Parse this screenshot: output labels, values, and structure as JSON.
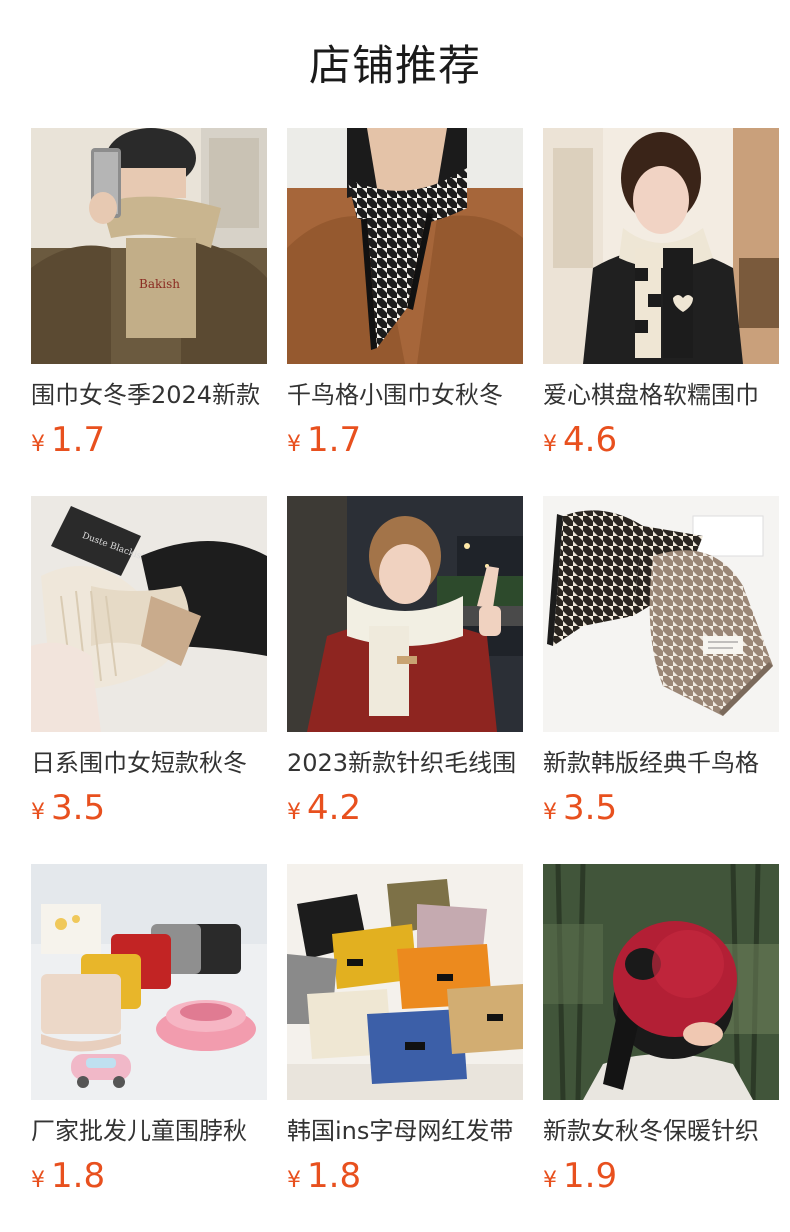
{
  "page": {
    "title": "店铺推荐",
    "currency_symbol": "¥",
    "price_color": "#e8501e"
  },
  "products": [
    {
      "name": "围巾女冬季2024新款",
      "price": "1.7",
      "image": "beige-knit-scarf-photo"
    },
    {
      "name": "千鸟格小围巾女秋冬",
      "price": "1.7",
      "image": "houndstooth-scarf-photo"
    },
    {
      "name": "爱心棋盘格软糯围巾",
      "price": "4.6",
      "image": "heart-checker-scarf-photo"
    },
    {
      "name": "日系围巾女短款秋冬",
      "price": "3.5",
      "image": "ribbed-bow-scarf-photo"
    },
    {
      "name": "2023新款针织毛线围",
      "price": "4.2",
      "image": "white-knit-scarf-photo"
    },
    {
      "name": "新款韩版经典千鸟格",
      "price": "3.5",
      "image": "houndstooth-pair-photo"
    },
    {
      "name": "厂家批发儿童围脖秋",
      "price": "1.8",
      "image": "kids-neck-warmer-photo"
    },
    {
      "name": "韩国ins字母网红发带",
      "price": "1.8",
      "image": "knit-headband-photo"
    },
    {
      "name": "新款女秋冬保暖针织",
      "price": "1.9",
      "image": "red-knit-hat-photo"
    }
  ]
}
